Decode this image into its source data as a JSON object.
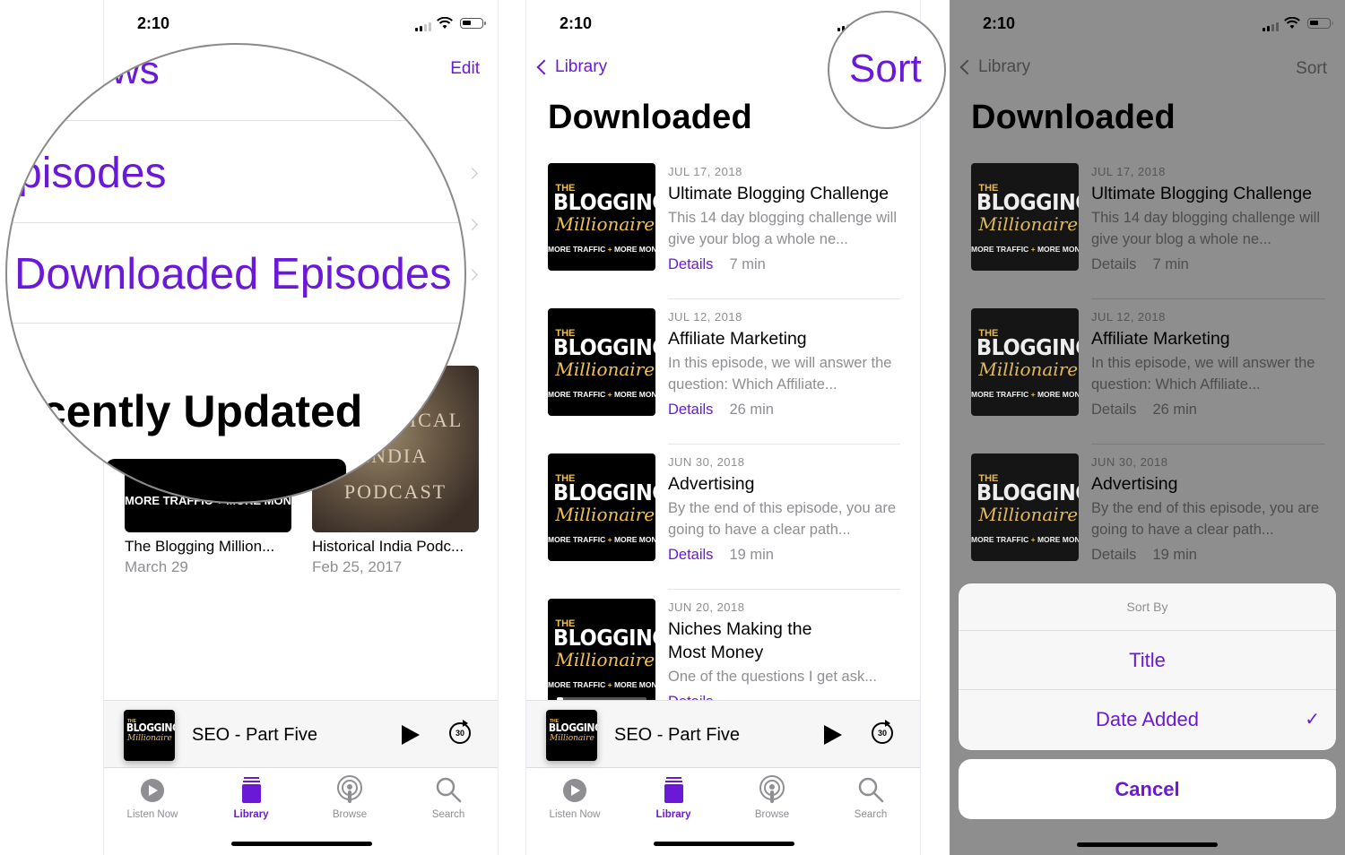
{
  "colors": {
    "accent": "#6a19d6",
    "secondary_text": "#8e8e93",
    "dim_overlay": "#8e8e8e"
  },
  "status_bar": {
    "time": "2:10"
  },
  "artwork": {
    "blogging_millionaire": {
      "the": "THE",
      "blogging": "BLOGGING",
      "millionaire": "Millionaire",
      "tagline_left": "MORE TRAFFIC",
      "tagline_plus": "+",
      "tagline_right": "MORE MONEY"
    },
    "historical_india": {
      "line1": "HISTORICAL",
      "line2": "INDIA",
      "line3": "PODCAST"
    }
  },
  "library_screen": {
    "title_fragment": "ws",
    "edit_label": "Edit",
    "rows": [
      {
        "label": "Episodes"
      },
      {
        "label": "Downloaded Episodes"
      }
    ],
    "recently_updated_heading": "Recently Updated",
    "recent": [
      {
        "title": "The Blogging Million...",
        "date": "March 29",
        "art_type": "blogging"
      },
      {
        "title": "Historical India Podc...",
        "date": "Feb 25, 2017",
        "art_type": "india"
      }
    ]
  },
  "downloaded_screen": {
    "back_label": "Library",
    "sort_label": "Sort",
    "title": "Downloaded",
    "episodes": [
      {
        "date": "JUL 17, 2018",
        "title": "Ultimate Blogging Challenge",
        "description": "This 14 day blogging challenge will give your blog a whole ne...",
        "details_label": "Details",
        "duration": "7 min"
      },
      {
        "date": "JUL 12, 2018",
        "title": "Affiliate Marketing",
        "description": "In this episode, we will answer the question: Which Affiliate...",
        "details_label": "Details",
        "duration": "26 min"
      },
      {
        "date": "JUN 30, 2018",
        "title": "Advertising",
        "description": "By the end of this episode, you are going to have a clear path...",
        "details_label": "Details",
        "duration": "19 min"
      },
      {
        "date": "JUN 20, 2018",
        "title": "Niches Making the Most Money",
        "description": "One of the questions I get ask...",
        "details_label": "Details",
        "duration": "",
        "progress": 0.07
      }
    ]
  },
  "sort_sheet": {
    "title": "Sort By",
    "options": [
      {
        "label": "Title",
        "selected": false
      },
      {
        "label": "Date Added",
        "selected": true
      }
    ],
    "check_glyph": "✓",
    "cancel_label": "Cancel"
  },
  "mini_player": {
    "title": "SEO - Part Five",
    "skip_label": "30"
  },
  "tab_bar": {
    "tabs": [
      {
        "label": "Listen Now",
        "icon": "play-circle-icon",
        "active": false
      },
      {
        "label": "Library",
        "icon": "library-stack-icon",
        "active": true
      },
      {
        "label": "Browse",
        "icon": "podcast-icon",
        "active": false
      },
      {
        "label": "Search",
        "icon": "search-icon",
        "active": false
      }
    ]
  }
}
